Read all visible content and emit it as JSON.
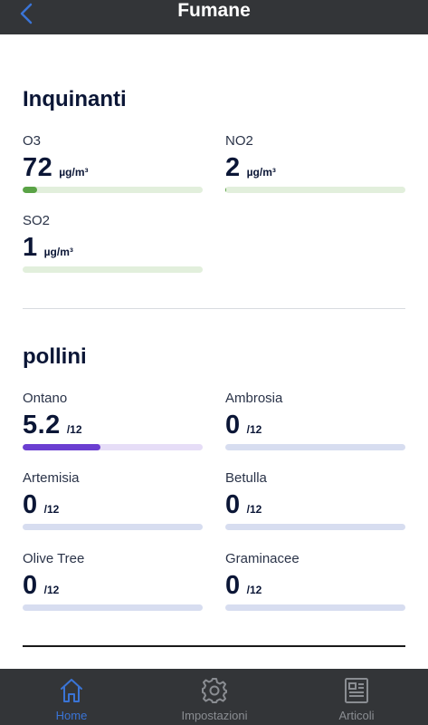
{
  "header": {
    "title": "Fumane"
  },
  "pollutants": {
    "title": "Inquinanti",
    "items": [
      {
        "name": "O3",
        "value": "72",
        "unit": "µg/m³",
        "fill": 0.08,
        "color": "#5aa346",
        "track": "#e2efdc"
      },
      {
        "name": "NO2",
        "value": "2",
        "unit": "µg/m³",
        "fill": 0.005,
        "color": "#5aa346",
        "track": "#e2efdc"
      },
      {
        "name": "SO2",
        "value": "1",
        "unit": "µg/m³",
        "fill": 0.0,
        "color": "#5aa346",
        "track": "#e2efdc"
      }
    ]
  },
  "pollen": {
    "title": "pollini",
    "items": [
      {
        "name": "Ontano",
        "value": "5.2",
        "unit": "/12",
        "fill": 0.43,
        "color": "#6b3fd1",
        "track": "#e6ddf7"
      },
      {
        "name": "Ambrosia",
        "value": "0",
        "unit": "/12",
        "fill": 0.0,
        "color": "#6b3fd1",
        "track": "#d7ddf0"
      },
      {
        "name": "Artemisia",
        "value": "0",
        "unit": "/12",
        "fill": 0.0,
        "color": "#6b3fd1",
        "track": "#d7ddf0"
      },
      {
        "name": "Betulla",
        "value": "0",
        "unit": "/12",
        "fill": 0.0,
        "color": "#6b3fd1",
        "track": "#d7ddf0"
      },
      {
        "name": "Olive Tree",
        "value": "0",
        "unit": "/12",
        "fill": 0.0,
        "color": "#6b3fd1",
        "track": "#d7ddf0"
      },
      {
        "name": "Graminacee",
        "value": "0",
        "unit": "/12",
        "fill": 0.0,
        "color": "#6b3fd1",
        "track": "#d7ddf0"
      }
    ]
  },
  "nav": {
    "items": [
      {
        "label": "Home",
        "icon": "home-icon",
        "active": true
      },
      {
        "label": "Impostazioni",
        "icon": "gear-icon",
        "active": false
      },
      {
        "label": "Articoli",
        "icon": "news-icon",
        "active": false
      }
    ],
    "active_color": "#3a74d6",
    "inactive_color": "#8a8d92"
  }
}
